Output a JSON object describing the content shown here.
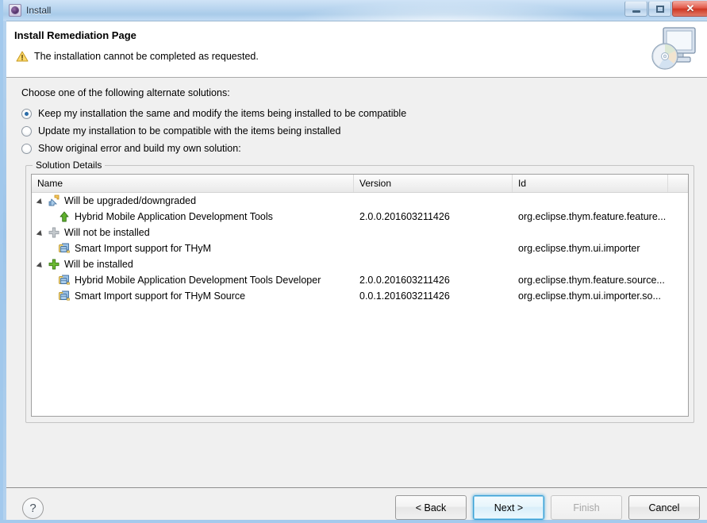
{
  "window": {
    "title": "Install",
    "icon": "eclipse-install-icon",
    "controls": {
      "minimize": "minimize-button",
      "maximize": "maximize-button",
      "close": "close-button",
      "close_glyph": "✕"
    }
  },
  "header": {
    "page_title": "Install Remediation Page",
    "message": "The installation cannot be completed as requested.",
    "message_icon": "warning-icon",
    "banner_icon": "install-monitor-disc-icon"
  },
  "body": {
    "choose_label": "Choose one of the following alternate solutions:",
    "options": [
      {
        "label": "Keep my installation the same and modify the items being installed to be compatible",
        "selected": true
      },
      {
        "label": "Update my installation to be compatible with the items being installed",
        "selected": false
      },
      {
        "label": "Show original error and build my own solution:",
        "selected": false
      }
    ]
  },
  "solution_details": {
    "group_label": "Solution Details",
    "columns": [
      "Name",
      "Version",
      "Id"
    ],
    "rows": [
      {
        "level": 0,
        "expanded": true,
        "icon": "upgrade-downgrade-icon",
        "name": "Will be upgraded/downgraded",
        "version": "",
        "id": ""
      },
      {
        "level": 1,
        "expanded": false,
        "icon": "green-up-arrow-icon",
        "name": "Hybrid Mobile Application Development Tools",
        "version": "2.0.0.201603211426",
        "id": "org.eclipse.thym.feature.feature..."
      },
      {
        "level": 0,
        "expanded": true,
        "icon": "gray-plus-icon",
        "name": "Will not be installed",
        "version": "",
        "id": ""
      },
      {
        "level": 1,
        "expanded": false,
        "icon": "feature-bundle-icon",
        "name": "Smart Import support for THyM",
        "version": "",
        "id": "org.eclipse.thym.ui.importer"
      },
      {
        "level": 0,
        "expanded": true,
        "icon": "green-plus-icon",
        "name": "Will be installed",
        "version": "",
        "id": ""
      },
      {
        "level": 1,
        "expanded": false,
        "icon": "feature-bundle-icon",
        "name": "Hybrid Mobile Application Development Tools Developer",
        "version": "2.0.0.201603211426",
        "id": "org.eclipse.thym.feature.source..."
      },
      {
        "level": 1,
        "expanded": false,
        "icon": "feature-bundle-icon",
        "name": "Smart Import support for THyM Source",
        "version": "0.0.1.201603211426",
        "id": "org.eclipse.thym.ui.importer.so..."
      }
    ]
  },
  "footer": {
    "help_label": "?",
    "buttons": [
      {
        "label": "< Back",
        "state": "normal"
      },
      {
        "label": "Next >",
        "state": "focused"
      },
      {
        "label": "Finish",
        "state": "disabled"
      },
      {
        "label": "Cancel",
        "state": "normal"
      }
    ]
  },
  "colors": {
    "accent": "#3c9fd4",
    "warning": "#f0c419",
    "install_green": "#5aa72b",
    "titlebar": "#b9d5ef",
    "close_red": "#cf3723"
  }
}
